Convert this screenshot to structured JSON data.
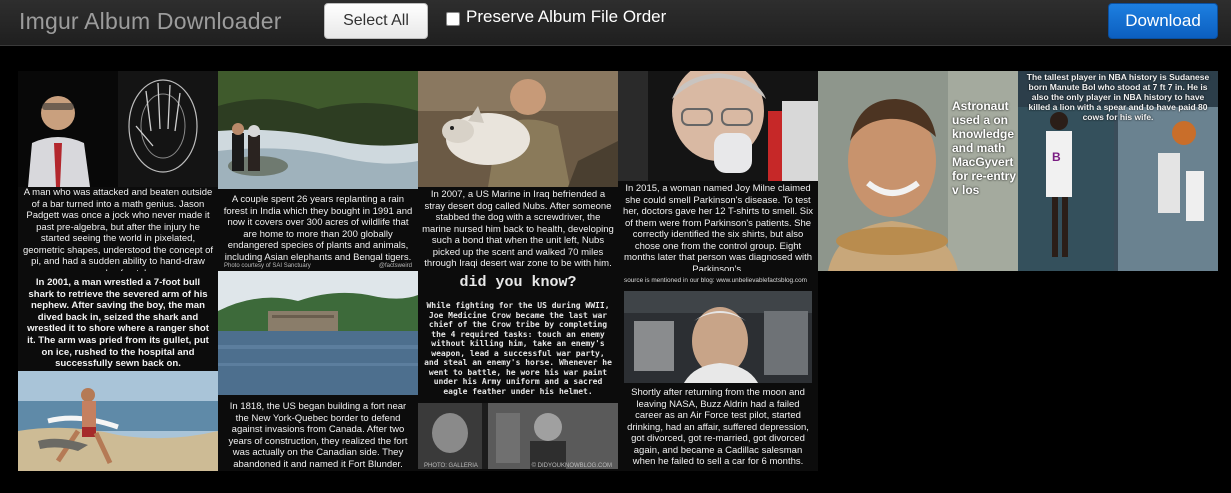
{
  "header": {
    "title": "Imgur Album Downloader",
    "select_all_label": "Select All",
    "preserve_label": "Preserve Album File Order",
    "download_label": "Download"
  },
  "tiles": [
    {
      "caption": "A man who was attacked and beaten outside of a bar turned into a math genius. Jason Padgett was once a jock who never made it past pre-algebra, but after the injury he started seeing the world in pixelated, geometric shapes, understood the concept of pi, and had a sudden ability to hand-draw complex fractals."
    },
    {
      "caption": "A couple spent 26 years replanting a rain forest in India which they bought in 1991 and now it covers over 300 acres of wildlife that are home to more than 200 globally endangered species of plants and animals, including Asian elephants and Bengal tigers.",
      "credit": "Photo courtesy of SAI Sanctuary",
      "handle": "@factsweird"
    },
    {
      "caption": "In 2007, a US Marine in Iraq befriended a stray desert dog called Nubs. After someone stabbed the dog with a screwdriver, the marine nursed him back to health, developing such a bond that when the unit left, Nubs picked up the scent and walked 70 miles through Iraqi desert war zone to be with him."
    },
    {
      "caption": "In 2015, a woman named Joy Milne claimed she could smell Parkinson's disease. To test her, doctors gave her 12 T-shirts to smell. Six of them were from Parkinson's patients. She correctly identified the six shirts, but also chose one from the control group. Eight months later that person was diagnosed with Parkinson's."
    },
    {
      "caption": "Astronaut used a on knowledge and math MacGyvert for re-entry v los"
    },
    {
      "caption": "The tallest player in NBA history is Sudanese born Manute Bol who stood at 7 ft 7 in. He is also the only player in NBA history to have killed a lion with a spear and to have paid 80 cows for his wife."
    },
    {
      "caption": "In 2001, a man wrestled a 7-foot bull shark to retrieve the severed arm of his nephew. After saving the boy, the man dived back in, seized the shark and wrestled it to shore where a ranger shot it. The arm was pried from its gullet, put on ice, rushed to the hospital and successfully sewn back on."
    },
    {
      "caption": "In 1818, the US began building a fort near the New York-Quebec border to defend against invasions from Canada. After two years of construction, they realized the fort was actually on the Canadian side. They abandoned it and named it Fort Blunder."
    },
    {
      "heading": "did you know?",
      "caption": "While fighting for the US during WWII, Joe Medicine Crow became the last war chief of the Crow tribe by completing the 4 required tasks: touch an enemy without killing him, take an enemy's weapon, lead a successful war party, and steal an enemy's horse. Whenever he went to battle, he wore his war paint under his Army uniform and a sacred eagle feather under his helmet.",
      "credit": "PHOTO: GALLERIA",
      "handle": "© DIDYOUKNOWBLOG.COM"
    },
    {
      "source": "source is mentioned in our blog: www.unbelievablefactsblog.com",
      "caption": "Shortly after returning from the moon and leaving NASA, Buzz Aldrin had a failed career as an Air Force test pilot, started drinking, had an affair, suffered depression, got divorced, got re-married, got divorced again, and became a Cadillac salesman when he failed to sell a car for 6 months."
    }
  ]
}
